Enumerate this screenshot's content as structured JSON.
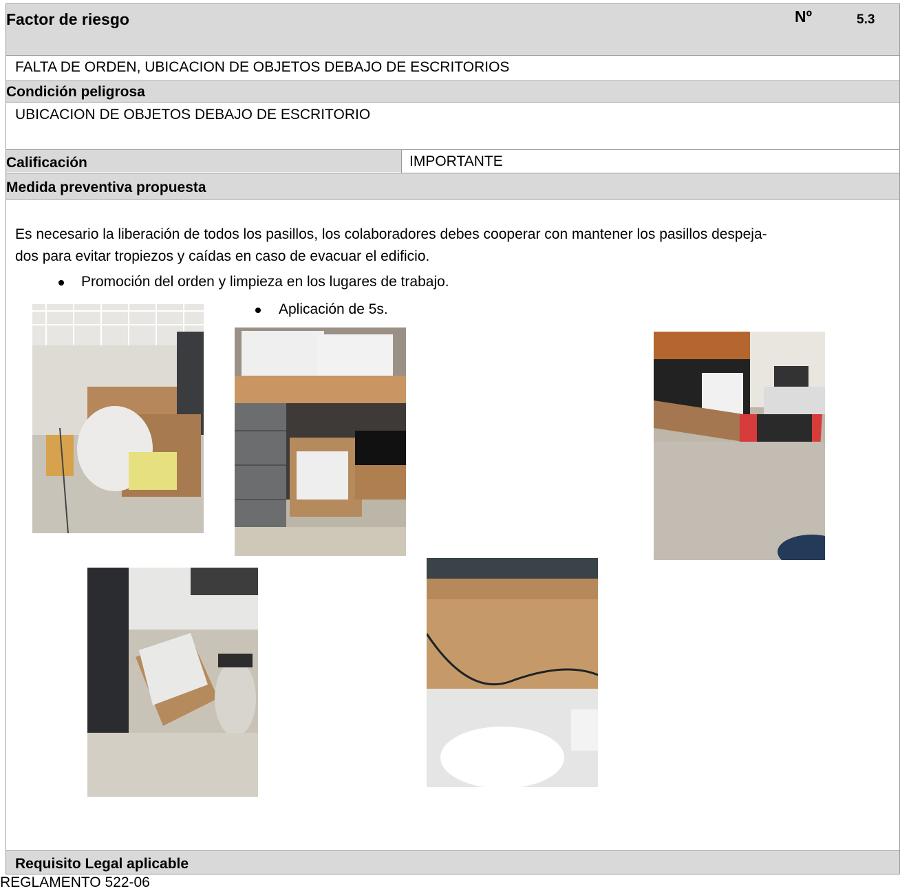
{
  "header": {
    "factor_label": "Factor de riesgo",
    "number_label": "Nº",
    "number_value": "5.3"
  },
  "factor": {
    "description": "FALTA DE ORDEN, UBICACION DE OBJETOS DEBAJO DE ESCRITORIOS"
  },
  "condicion": {
    "label": "Condición peligrosa",
    "value": "UBICACION DE OBJETOS DEBAJO DE ESCRITORIO"
  },
  "calificacion": {
    "label": "Calificación",
    "value": "IMPORTANTE"
  },
  "medida": {
    "label": "Medida preventiva propuesta",
    "paragraph_line1": "Es necesario la liberación de todos los pasillos, los colaboradores debes cooperar con mantener los pasillos despeja-",
    "paragraph_line2": "dos para evitar tropiezos y caídas en caso de evacuar el edificio.",
    "bullets": [
      "Promoción del orden y limpieza en los lugares de trabajo.",
      "Aplicación de 5s."
    ]
  },
  "requisito": {
    "label": "Requisito Legal aplicable",
    "value": "REGLAMENTO 522-06"
  }
}
